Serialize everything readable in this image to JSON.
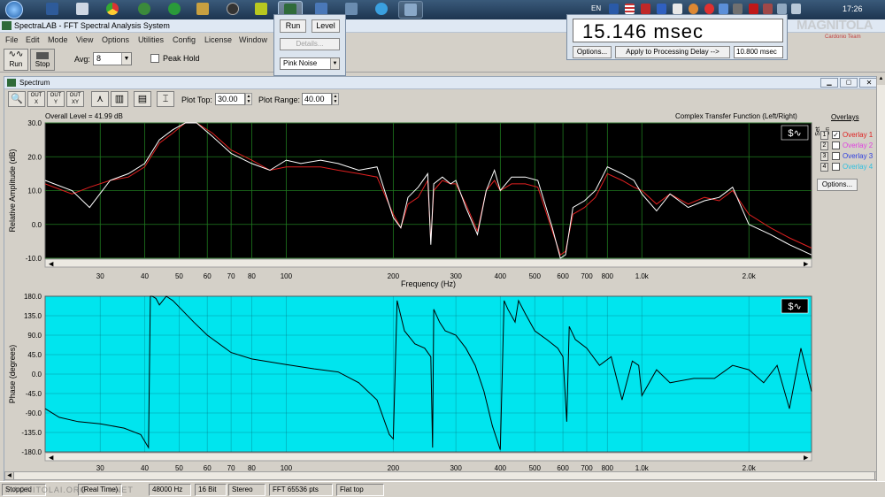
{
  "taskbar": {
    "language": "EN",
    "clock": "17:26",
    "brand": "MAGNITOLA",
    "brand_sub": "Cardonio Team"
  },
  "window": {
    "title": "SpectraLAB - FFT Spectral Analysis System"
  },
  "menu": [
    "File",
    "Edit",
    "Mode",
    "View",
    "Options",
    "Utilities",
    "Config",
    "License",
    "Window"
  ],
  "toolbar": {
    "run_label": "Run",
    "stop_label": "Stop",
    "avg_label": "Avg:",
    "avg_value": "8",
    "peak_hold_label": "Peak Hold"
  },
  "generator_popup": {
    "run_label": "Run",
    "level_label": "Level",
    "details_label": "Details...",
    "signal_value": "Pink Noise"
  },
  "delay_popup": {
    "readout": "15.146 msec",
    "options_label": "Options...",
    "apply_label": "Apply to Processing Delay -->",
    "delay_value": "10.800 msec"
  },
  "spectrum_window": {
    "title": "Spectrum",
    "plot_top_label": "Plot Top:",
    "plot_top_value": "30.00",
    "plot_range_label": "Plot Range:",
    "plot_range_value": "40.00"
  },
  "overlays": {
    "header": "Overlays",
    "set_label": "Set",
    "on_label": "On",
    "items": [
      {
        "num": "1",
        "label": "Overlay 1",
        "checked": true,
        "color": "#e02020"
      },
      {
        "num": "2",
        "label": "Overlay 2",
        "checked": false,
        "color": "#e040e0"
      },
      {
        "num": "3",
        "label": "Overlay 3",
        "checked": false,
        "color": "#3040e0"
      },
      {
        "num": "4",
        "label": "Overlay 4",
        "checked": false,
        "color": "#30c0e0"
      }
    ],
    "options_label": "Options..."
  },
  "amplitude_plot": {
    "overall_level": "Overall Level = 41.99 dB",
    "function_label": "Complex Transfer Function (Left/Right)",
    "ylabel": "Relative Amplitude (dB)",
    "xlabel": "Frequency (Hz)",
    "bg_color": "#000000",
    "grid_color": "#1f7a1f"
  },
  "phase_plot": {
    "ylabel": "Phase (degrees)",
    "bg_color": "#00e5ee"
  },
  "statusbar": {
    "state": "Stopped",
    "mode": "(Real Time)",
    "sample_rate": "48000 Hz",
    "bits": "16 Bit",
    "channels": "Stereo",
    "fft": "FFT 65536 pts",
    "window": "Flat top",
    "watermark": "MAGNITOLAI.ORG       I.NET"
  },
  "chart_data": [
    {
      "type": "line",
      "ylabel": "Relative Amplitude (dB)",
      "xlabel": "Frequency (Hz)",
      "xscale": "log",
      "xlim": [
        21,
        3000
      ],
      "ylim": [
        -10,
        30
      ],
      "yticks": [
        30.0,
        20.0,
        10.0,
        0.0,
        -10.0
      ],
      "xticks": [
        30,
        40,
        50,
        60,
        70,
        80,
        100,
        200,
        300,
        400,
        500,
        600,
        700,
        800,
        1000,
        2000
      ],
      "xtick_labels": [
        "30",
        "40",
        "50",
        "60",
        "70",
        "80",
        "100",
        "200",
        "300",
        "400",
        "500",
        "600",
        "700",
        "800",
        "1.0k",
        "2.0k"
      ],
      "grid": true,
      "series": [
        {
          "name": "Overlay 1",
          "color": "#e02020",
          "x": [
            21,
            25,
            28,
            32,
            36,
            40,
            44,
            48,
            52,
            56,
            62,
            70,
            80,
            90,
            100,
            110,
            125,
            140,
            160,
            180,
            200,
            210,
            220,
            235,
            250,
            255,
            260,
            275,
            290,
            300,
            320,
            345,
            365,
            385,
            400,
            430,
            470,
            510,
            560,
            590,
            610,
            640,
            690,
            740,
            800,
            880,
            950,
            1000,
            1100,
            1200,
            1350,
            1500,
            1650,
            1800,
            2000,
            2300,
            2600,
            3000
          ],
          "y": [
            12,
            9,
            11,
            13,
            14,
            17,
            24,
            27,
            30,
            30,
            27,
            22,
            19,
            16,
            17,
            17,
            17,
            16,
            15,
            14,
            3,
            -1,
            6,
            8,
            13,
            -5,
            10,
            13,
            12,
            12,
            6,
            -2,
            10,
            13,
            10,
            12,
            12,
            11,
            -2,
            -9,
            -8,
            3,
            5,
            8,
            15,
            13,
            11,
            10,
            6,
            9,
            6,
            8,
            7,
            10,
            3,
            -1,
            -4,
            -7
          ]
        },
        {
          "name": "",
          "color": "#ffffff",
          "x": [
            21,
            25,
            28,
            32,
            36,
            40,
            44,
            48,
            52,
            56,
            62,
            70,
            80,
            90,
            100,
            110,
            125,
            140,
            160,
            180,
            200,
            210,
            220,
            235,
            250,
            255,
            260,
            275,
            290,
            300,
            320,
            345,
            365,
            385,
            400,
            430,
            470,
            510,
            560,
            590,
            610,
            640,
            690,
            740,
            800,
            880,
            950,
            1000,
            1100,
            1200,
            1350,
            1500,
            1650,
            1800,
            2000,
            2300,
            2600,
            3000
          ],
          "y": [
            13,
            10,
            5,
            13,
            15,
            18,
            25,
            28,
            30,
            30,
            26,
            21,
            18,
            16,
            19,
            18,
            19,
            18,
            16,
            17,
            2,
            -1,
            8,
            11,
            15,
            -6,
            12,
            14,
            12,
            13,
            5,
            -3,
            10,
            16,
            10,
            14,
            14,
            13,
            -1,
            -10,
            -9,
            5,
            7,
            10,
            17,
            15,
            13,
            9,
            4,
            9,
            5,
            7,
            8,
            11,
            0,
            -3,
            -6,
            -9
          ]
        }
      ]
    },
    {
      "type": "line",
      "ylabel": "Phase (degrees)",
      "xscale": "log",
      "xlim": [
        21,
        3000
      ],
      "ylim": [
        -180,
        180
      ],
      "yticks": [
        180.0,
        135.0,
        90.0,
        45.0,
        0.0,
        -45.0,
        -90.0,
        -135.0,
        -180.0
      ],
      "ytick_labels": [
        "180.0",
        "135.0",
        "90.0",
        "45.0",
        "0.0",
        "-45.0",
        "-90.0",
        "-135.0",
        "-180.0"
      ],
      "xticks": [
        30,
        40,
        50,
        60,
        70,
        80,
        100,
        200,
        300,
        400,
        500,
        600,
        700,
        800,
        1000,
        2000
      ],
      "xtick_labels": [
        "30",
        "40",
        "50",
        "60",
        "70",
        "80",
        "100",
        "200",
        "300",
        "400",
        "500",
        "600",
        "700",
        "800",
        "1.0k",
        "2.0k"
      ],
      "series": [
        {
          "name": "",
          "color": "#000000",
          "x": [
            21,
            23,
            26,
            30,
            35,
            39,
            41,
            41.5,
            42,
            43,
            44,
            46,
            48,
            50,
            55,
            60,
            70,
            80,
            90,
            100,
            120,
            140,
            160,
            180,
            195,
            200,
            205,
            215,
            230,
            245,
            255,
            258,
            260,
            270,
            280,
            300,
            320,
            340,
            360,
            380,
            400,
            410,
            420,
            440,
            450,
            470,
            500,
            540,
            580,
            600,
            615,
            625,
            650,
            700,
            760,
            820,
            880,
            940,
            980,
            1000,
            1100,
            1200,
            1400,
            1600,
            1800,
            2000,
            2200,
            2400,
            2600,
            2800,
            3000
          ],
          "y": [
            -80,
            -100,
            -110,
            -115,
            -125,
            -140,
            -170,
            180,
            180,
            175,
            160,
            180,
            170,
            155,
            120,
            90,
            50,
            35,
            28,
            22,
            12,
            5,
            -20,
            -60,
            -140,
            -150,
            170,
            100,
            70,
            60,
            40,
            -170,
            150,
            120,
            100,
            90,
            60,
            20,
            -40,
            -120,
            -175,
            170,
            150,
            120,
            170,
            140,
            100,
            80,
            60,
            40,
            -110,
            110,
            80,
            60,
            20,
            40,
            -60,
            30,
            20,
            -50,
            10,
            -20,
            -10,
            -10,
            20,
            10,
            -20,
            20,
            -80,
            60,
            -40
          ]
        }
      ]
    }
  ]
}
